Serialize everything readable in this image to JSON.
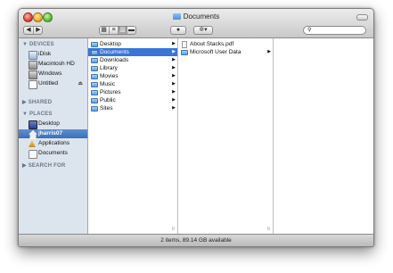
{
  "window": {
    "title": "Documents"
  },
  "toolbar": {
    "back_icon": "back-arrow-icon",
    "forward_icon": "forward-arrow-icon",
    "view_modes": [
      "icon-view-icon",
      "list-view-icon",
      "column-view-icon",
      "coverflow-view-icon"
    ],
    "active_view": "column-view-icon",
    "quicklook_icon": "eye-icon",
    "action_icon": "gear-icon",
    "search_icon": "magnifier-icon"
  },
  "sidebar": {
    "devices_header": "DEVICES",
    "devices": [
      "iDisk",
      "Macintosh HD",
      "Windows",
      "Untitled"
    ],
    "shared_header": "SHARED",
    "places_header": "PLACES",
    "places": [
      "Desktop",
      "jharris07",
      "Applications",
      "Documents"
    ],
    "selected_place": "jharris07",
    "search_header": "SEARCH FOR"
  },
  "columns": {
    "col1": [
      "Desktop",
      "Documents",
      "Downloads",
      "Library",
      "Movies",
      "Music",
      "Pictures",
      "Public",
      "Sites"
    ],
    "col1_selected": "Documents",
    "col2": [
      "About Stacks.pdf",
      "Microsoft User Data"
    ]
  },
  "status": {
    "text": "2 items, 89.14 GB available"
  },
  "colors": {
    "selection": "#3875d7",
    "sidebar_bg": "#dce4ee"
  }
}
